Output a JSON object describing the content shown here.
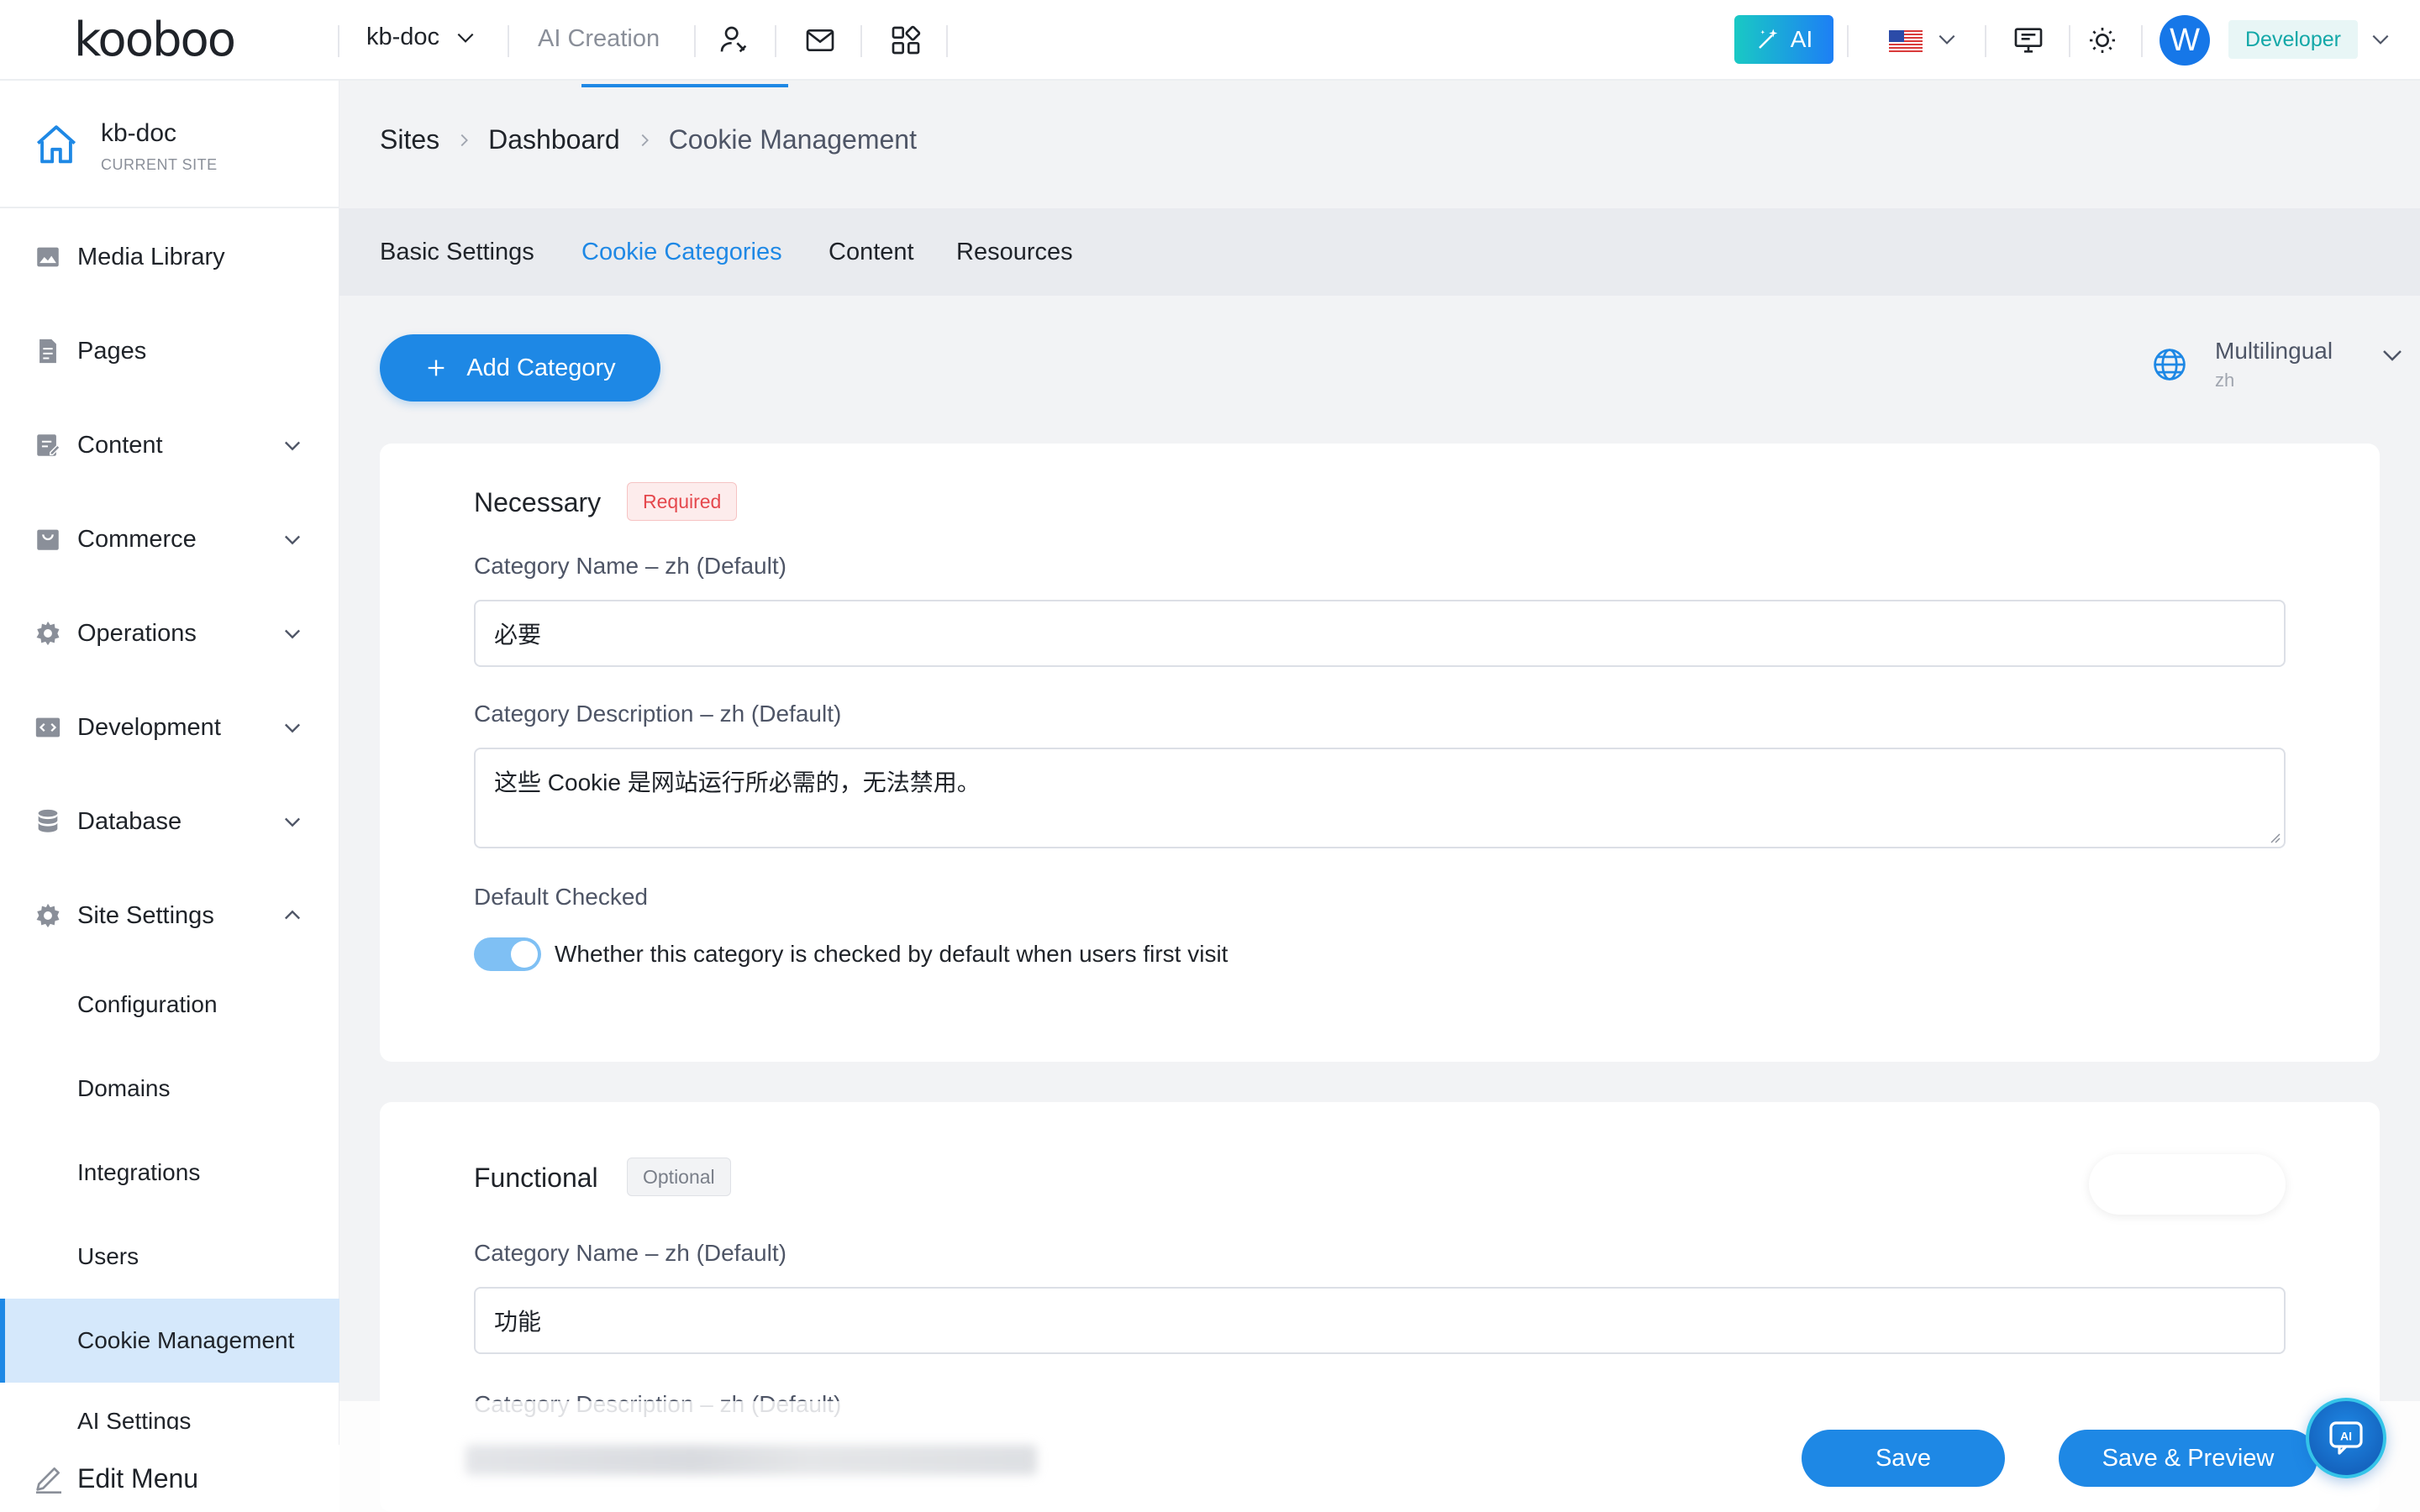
{
  "topbar": {
    "logo_text": "kooboo",
    "site_name": "kb-doc",
    "ai_creation": "AI Creation",
    "ai_button": "AI",
    "avatar_letter": "W",
    "role": "Developer"
  },
  "sidebar": {
    "site_name": "kb-doc",
    "site_sub": "CURRENT SITE",
    "items": [
      {
        "label": "Media Library"
      },
      {
        "label": "Pages"
      },
      {
        "label": "Content"
      },
      {
        "label": "Commerce"
      },
      {
        "label": "Operations"
      },
      {
        "label": "Development"
      },
      {
        "label": "Database"
      },
      {
        "label": "Site Settings"
      }
    ],
    "sub_items": [
      {
        "label": "Configuration"
      },
      {
        "label": "Domains"
      },
      {
        "label": "Integrations"
      },
      {
        "label": "Users"
      },
      {
        "label": "Cookie Management"
      },
      {
        "label": "AI Settings"
      }
    ],
    "edit_menu": "Edit Menu"
  },
  "breadcrumb": [
    "Sites",
    "Dashboard",
    "Cookie Management"
  ],
  "tabs": [
    "Basic Settings",
    "Cookie Categories",
    "Content",
    "Resources"
  ],
  "active_tab": "Cookie Categories",
  "toolbar": {
    "add_category": "Add Category",
    "multilingual": "Multilingual",
    "language": "zh"
  },
  "categories": [
    {
      "title": "Necessary",
      "tag": "Required",
      "name_label": "Category Name – zh (Default)",
      "name_value": "必要",
      "desc_label": "Category Description – zh (Default)",
      "desc_value": "这些 Cookie 是网站运行所必需的，无法禁用。",
      "default_checked_label": "Default Checked",
      "toggle_text": "Whether this category is checked by default when users first visit",
      "default_checked": true
    },
    {
      "title": "Functional",
      "tag": "Optional",
      "name_label": "Category Name – zh (Default)",
      "name_value": "功能",
      "desc_label": "Category Description – zh (Default)"
    }
  ],
  "actions": {
    "save": "Save",
    "save_preview": "Save & Preview"
  },
  "colors": {
    "primary": "#1e88e5",
    "active_nav_bg": "#d5e8fb",
    "required_tag": "#e5484d",
    "role_badge": "#13a8a8"
  }
}
